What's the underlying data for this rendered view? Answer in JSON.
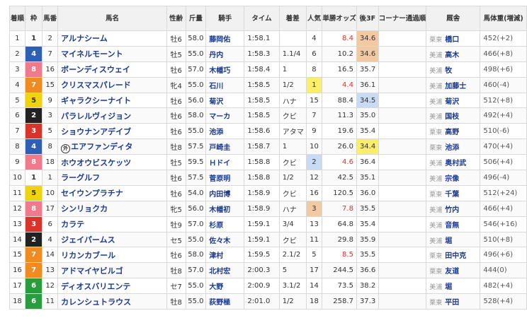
{
  "headers": {
    "rank": "着順",
    "waku": "枠",
    "umaban": "馬番",
    "horse": "馬名",
    "sexage": "性齢",
    "kinryo": "斤量",
    "jockey": "騎手",
    "time": "タイム",
    "margin": "着差",
    "pop": "人気",
    "odds": "単勝オッズ",
    "last3f": "後3F",
    "corner": "コーナー通過順",
    "trainer": "厩舎",
    "weight": "馬体重(増減)"
  },
  "rows": [
    {
      "rank": "1",
      "waku": "1",
      "umaban": "2",
      "horse": "アルナシーム",
      "mark": "",
      "sexage": "牡6",
      "kinryo": "58.0",
      "jockey": "藤岡佑",
      "time": "1:58.1",
      "margin": "",
      "pop": "4",
      "odds": "8.4",
      "odds_red": true,
      "last3f": "34.6",
      "last3f_rank": 1,
      "region": "栗東",
      "trainer": "橋口",
      "weight": "452(+2)"
    },
    {
      "rank": "2",
      "waku": "4",
      "umaban": "7",
      "horse": "マイネルモーント",
      "mark": "",
      "sexage": "牡5",
      "kinryo": "55.0",
      "jockey": "丹内",
      "time": "1:58.3",
      "margin": "1.1/4",
      "pop": "6",
      "odds": "10.2",
      "odds_red": false,
      "last3f": "34.6",
      "last3f_rank": 2,
      "region": "美浦",
      "trainer": "高木",
      "weight": "466(+8)"
    },
    {
      "rank": "3",
      "waku": "8",
      "umaban": "16",
      "horse": "ボーンディスウェイ",
      "mark": "",
      "sexage": "牡6",
      "kinryo": "57.0",
      "jockey": "木幡巧",
      "time": "1:58.4",
      "margin": "1",
      "pop": "8",
      "odds": "16.5",
      "odds_red": false,
      "last3f": "35.7",
      "last3f_rank": 0,
      "region": "美浦",
      "trainer": "牧",
      "weight": "498(+6)"
    },
    {
      "rank": "4",
      "waku": "7",
      "umaban": "15",
      "horse": "クリスマスパレード",
      "mark": "",
      "sexage": "牝4",
      "kinryo": "55.0",
      "jockey": "石川",
      "time": "1:58.5",
      "margin": "1/2",
      "pop": "1",
      "odds": "4.4",
      "odds_red": true,
      "last3f": "36.1",
      "last3f_rank": 0,
      "region": "美浦",
      "trainer": "加藤士",
      "weight": "460(-4)"
    },
    {
      "rank": "5",
      "waku": "5",
      "umaban": "9",
      "horse": "ギャラクシーナイト",
      "mark": "",
      "sexage": "牡6",
      "kinryo": "56.0",
      "jockey": "菊沢",
      "time": "1:58.5",
      "margin": "ハナ",
      "pop": "15",
      "odds": "88.4",
      "odds_red": false,
      "last3f": "34.5",
      "last3f_rank": 3,
      "region": "美浦",
      "trainer": "菊沢",
      "weight": "512(+8)"
    },
    {
      "rank": "6",
      "waku": "2",
      "umaban": "3",
      "horse": "パラレルヴィジョン",
      "mark": "",
      "sexage": "牡6",
      "kinryo": "58.0",
      "jockey": "マーカ",
      "time": "1:58.5",
      "margin": "クビ",
      "pop": "7",
      "odds": "11.3",
      "odds_red": false,
      "last3f": "35.0",
      "last3f_rank": 0,
      "region": "美浦",
      "trainer": "国枝",
      "weight": "492(+4)"
    },
    {
      "rank": "7",
      "waku": "3",
      "umaban": "5",
      "horse": "ショウナンアデイブ",
      "mark": "",
      "sexage": "牡6",
      "kinryo": "55.0",
      "jockey": "池添",
      "time": "1:58.6",
      "margin": "アタマ",
      "pop": "9",
      "odds": "19.6",
      "odds_red": false,
      "last3f": "35.4",
      "last3f_rank": 0,
      "region": "栗東",
      "trainer": "高野",
      "weight": "510(-6)"
    },
    {
      "rank": "8",
      "waku": "4",
      "umaban": "8",
      "horse": "エアファンディタ",
      "mark": "外",
      "sexage": "牡8",
      "kinryo": "57.5",
      "jockey": "戸崎圭",
      "time": "1:58.7",
      "margin": "1",
      "pop": "10",
      "odds": "26.0",
      "odds_red": false,
      "last3f": "34.4",
      "last3f_rank": 4,
      "region": "栗東",
      "trainer": "池添",
      "weight": "470(+4)"
    },
    {
      "rank": "9",
      "waku": "8",
      "umaban": "18",
      "horse": "ホウオウビスケッツ",
      "mark": "",
      "sexage": "牡5",
      "kinryo": "59.5",
      "jockey": "Ｈドイ",
      "time": "1:58.8",
      "margin": "クビ",
      "pop": "2",
      "odds": "4.6",
      "odds_red": true,
      "last3f": "36.4",
      "last3f_rank": 0,
      "region": "美浦",
      "trainer": "奥村武",
      "weight": "506(+4)"
    },
    {
      "rank": "10",
      "waku": "1",
      "umaban": "1",
      "horse": "ラーグルフ",
      "mark": "",
      "sexage": "牡6",
      "kinryo": "57.5",
      "jockey": "菅原明",
      "time": "1:58.8",
      "margin": "1/2",
      "pop": "12",
      "odds": "42.5",
      "odds_red": false,
      "last3f": "35.1",
      "last3f_rank": 0,
      "region": "美浦",
      "trainer": "宗像",
      "weight": "496(-4)"
    },
    {
      "rank": "11",
      "waku": "5",
      "umaban": "10",
      "horse": "セイウンプラチナ",
      "mark": "",
      "sexage": "牡6",
      "kinryo": "54.0",
      "jockey": "内田博",
      "time": "1:58.9",
      "margin": "クビ",
      "pop": "16",
      "odds": "120.5",
      "odds_red": false,
      "last3f": "36.0",
      "last3f_rank": 0,
      "region": "栗東",
      "trainer": "千葉",
      "weight": "512(+24)"
    },
    {
      "rank": "12",
      "waku": "8",
      "umaban": "17",
      "horse": "シンリョクカ",
      "mark": "",
      "sexage": "牝5",
      "kinryo": "56.0",
      "jockey": "木幡初",
      "time": "1:58.9",
      "margin": "ハナ",
      "pop": "3",
      "odds": "7.8",
      "odds_red": true,
      "last3f": "35.5",
      "last3f_rank": 0,
      "region": "美浦",
      "trainer": "竹内",
      "weight": "466(+4)"
    },
    {
      "rank": "13",
      "waku": "3",
      "umaban": "6",
      "horse": "カラテ",
      "mark": "",
      "sexage": "牡9",
      "kinryo": "57.0",
      "jockey": "杉原",
      "time": "1:59.1",
      "margin": "3/4",
      "pop": "13",
      "odds": "64.8",
      "odds_red": false,
      "last3f": "35.4",
      "last3f_rank": 0,
      "region": "美浦",
      "trainer": "音無",
      "weight": "546(+16)"
    },
    {
      "rank": "14",
      "waku": "2",
      "umaban": "4",
      "horse": "ジェイパームス",
      "mark": "",
      "sexage": "セ5",
      "kinryo": "55.0",
      "jockey": "佐々木",
      "time": "1:59.1",
      "margin": "クビ",
      "pop": "11",
      "odds": "29.8",
      "odds_red": false,
      "last3f": "35.9",
      "last3f_rank": 0,
      "region": "美浦",
      "trainer": "堀",
      "weight": "510(+8)"
    },
    {
      "rank": "15",
      "waku": "7",
      "umaban": "14",
      "horse": "リカンカブール",
      "mark": "",
      "sexage": "牡6",
      "kinryo": "58.0",
      "jockey": "津村",
      "time": "1:59.5",
      "margin": "2.1/2",
      "pop": "5",
      "odds": "8.5",
      "odds_red": true,
      "last3f": "35.5",
      "last3f_rank": 0,
      "region": "栗東",
      "trainer": "田中克",
      "weight": "496(+6)"
    },
    {
      "rank": "16",
      "waku": "7",
      "umaban": "13",
      "horse": "アドマイヤビルゴ",
      "mark": "",
      "sexage": "牡8",
      "kinryo": "57.0",
      "jockey": "北村宏",
      "time": "2:00.3",
      "margin": "5",
      "pop": "17",
      "odds": "244.5",
      "odds_red": false,
      "last3f": "36.6",
      "last3f_rank": 0,
      "region": "栗東",
      "trainer": "友道",
      "weight": "444(0)"
    },
    {
      "rank": "17",
      "waku": "6",
      "umaban": "12",
      "horse": "ディオスバリエンテ",
      "mark": "",
      "sexage": "セ7",
      "kinryo": "55.0",
      "jockey": "大野",
      "time": "2:00.9",
      "margin": "3.1/2",
      "pop": "14",
      "odds": "73.5",
      "odds_red": false,
      "last3f": "38.2",
      "last3f_rank": 0,
      "region": "美浦",
      "trainer": "堀",
      "weight": "482(+4)"
    },
    {
      "rank": "18",
      "waku": "6",
      "umaban": "11",
      "horse": "カレンシュトラウス",
      "mark": "",
      "sexage": "牡8",
      "kinryo": "55.0",
      "jockey": "荻野極",
      "time": "2:01.0",
      "margin": "1/2",
      "pop": "18",
      "odds": "258.7",
      "odds_red": false,
      "last3f": "37.3",
      "last3f_rank": 0,
      "region": "栗東",
      "trainer": "平田",
      "weight": "528(+4)"
    }
  ]
}
